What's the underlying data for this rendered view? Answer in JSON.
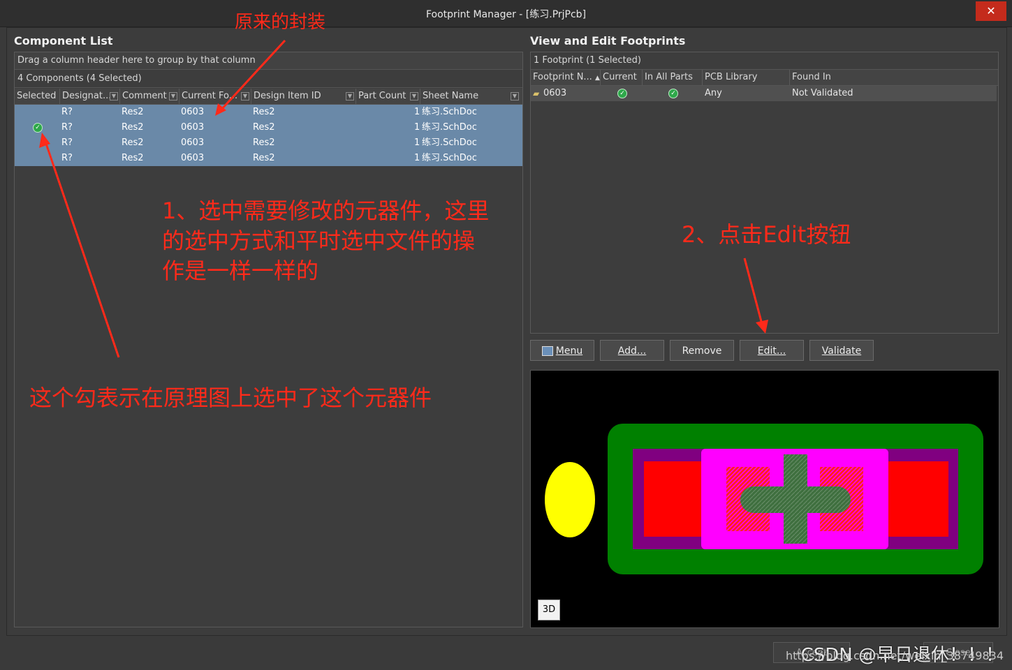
{
  "window": {
    "title": "Footprint Manager - [练习.PrjPcb]",
    "close_glyph": "✕"
  },
  "left": {
    "title": "Component List",
    "group_hint": "Drag a column header here to group by that column",
    "summary": "4 Components (4 Selected)",
    "columns": [
      "Selected",
      "Designat...",
      "Comment",
      "Current Fo...",
      "Design Item ID",
      "Part Count",
      "Sheet Name"
    ],
    "rows": [
      {
        "selected": false,
        "designator": "R?",
        "comment": "Res2",
        "footprint": "0603",
        "design_item": "Res2",
        "part_count": "1",
        "sheet": "练习.SchDoc"
      },
      {
        "selected": true,
        "designator": "R?",
        "comment": "Res2",
        "footprint": "0603",
        "design_item": "Res2",
        "part_count": "1",
        "sheet": "练习.SchDoc"
      },
      {
        "selected": false,
        "designator": "R?",
        "comment": "Res2",
        "footprint": "0603",
        "design_item": "Res2",
        "part_count": "1",
        "sheet": "练习.SchDoc"
      },
      {
        "selected": false,
        "designator": "R?",
        "comment": "Res2",
        "footprint": "0603",
        "design_item": "Res2",
        "part_count": "1",
        "sheet": "练习.SchDoc"
      }
    ]
  },
  "right": {
    "title": "View and Edit Footprints",
    "summary": "1 Footprint (1 Selected)",
    "columns": [
      "Footprint N...",
      "Current",
      "In All Parts",
      "PCB Library",
      "Found In"
    ],
    "row": {
      "name": "0603",
      "pcb_library": "Any",
      "found_in": "Not Validated"
    },
    "buttons": {
      "menu": "Menu",
      "add": "Add...",
      "remove": "Remove",
      "edit": "Edit...",
      "validate": "Validate"
    },
    "btn_3d": "3D"
  },
  "annotations": {
    "original_footprint": "原来的封装",
    "step1_line1": "1、选中需要修改的元器件，这里",
    "step1_line2": "的选中方式和平时选中文件的操",
    "step1_line3": "作是一样一样的",
    "step2": "2、点击Edit按钮",
    "checkmark_note": "这个勾表示在原理图上选中了这个元器件"
  },
  "footer": {
    "accept": "Accept",
    "close": "Close",
    "watermark": "CSDN @早日退休！！！",
    "watermark_url": "https://blog.csdn.net/weixin_38749834"
  }
}
